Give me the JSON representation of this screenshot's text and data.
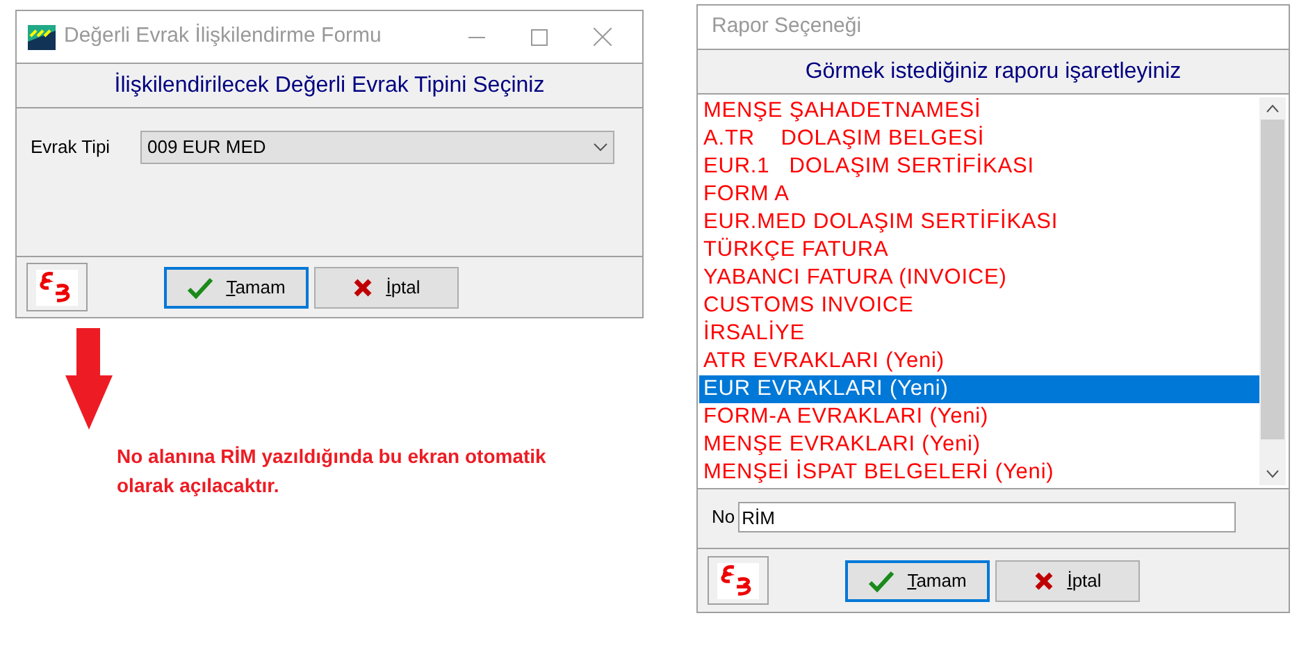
{
  "windows": [
    {
      "title": "Değerli Evrak İlişkilendirme Formu",
      "has_controls": true,
      "header": "İlişkilendirilecek Değerli Evrak Tipini Seçiniz",
      "field": {
        "label": "Evrak Tipi",
        "value": "009 EUR MED"
      },
      "buttons": [
        {
          "kind": "ok",
          "label": "Tamam",
          "focused": true
        },
        {
          "kind": "cancel",
          "label": "İptal",
          "focused": false
        }
      ]
    },
    {
      "title": "Rapor Seçeneği",
      "has_controls": false,
      "header": "Görmek istediğiniz raporu işaretleyiniz",
      "list": [
        {
          "label": "MENŞE ŞAHADETNAMESİ",
          "selected": false
        },
        {
          "label": "A.TR    DOLAŞIM BELGESİ",
          "selected": false
        },
        {
          "label": "EUR.1   DOLAŞIM SERTİFİKASI",
          "selected": false
        },
        {
          "label": "FORM A",
          "selected": false
        },
        {
          "label": "EUR.MED DOLAŞIM SERTİFİKASI",
          "selected": false
        },
        {
          "label": "TÜRKÇE FATURA",
          "selected": false
        },
        {
          "label": "YABANCI FATURA (INVOICE)",
          "selected": false
        },
        {
          "label": "CUSTOMS INVOICE",
          "selected": false
        },
        {
          "label": "İRSALİYE",
          "selected": false
        },
        {
          "label": "ATR EVRAKLARI (Yeni)",
          "selected": false
        },
        {
          "label": "EUR EVRAKLARI (Yeni)",
          "selected": true
        },
        {
          "label": "FORM-A EVRAKLARI (Yeni)",
          "selected": false
        },
        {
          "label": "MENŞE EVRAKLARI (Yeni)",
          "selected": false
        },
        {
          "label": "MENŞEİ İSPAT BELGELERİ (Yeni)",
          "selected": false
        }
      ],
      "field": {
        "label": "No",
        "value": "RİM"
      },
      "buttons": [
        {
          "kind": "ok",
          "label": "Tamam",
          "focused": true
        },
        {
          "kind": "cancel",
          "label": "İptal",
          "focused": false
        }
      ]
    }
  ],
  "note": "No alanına RİM yazıldığında bu ekran otomatik olarak açılacaktır."
}
